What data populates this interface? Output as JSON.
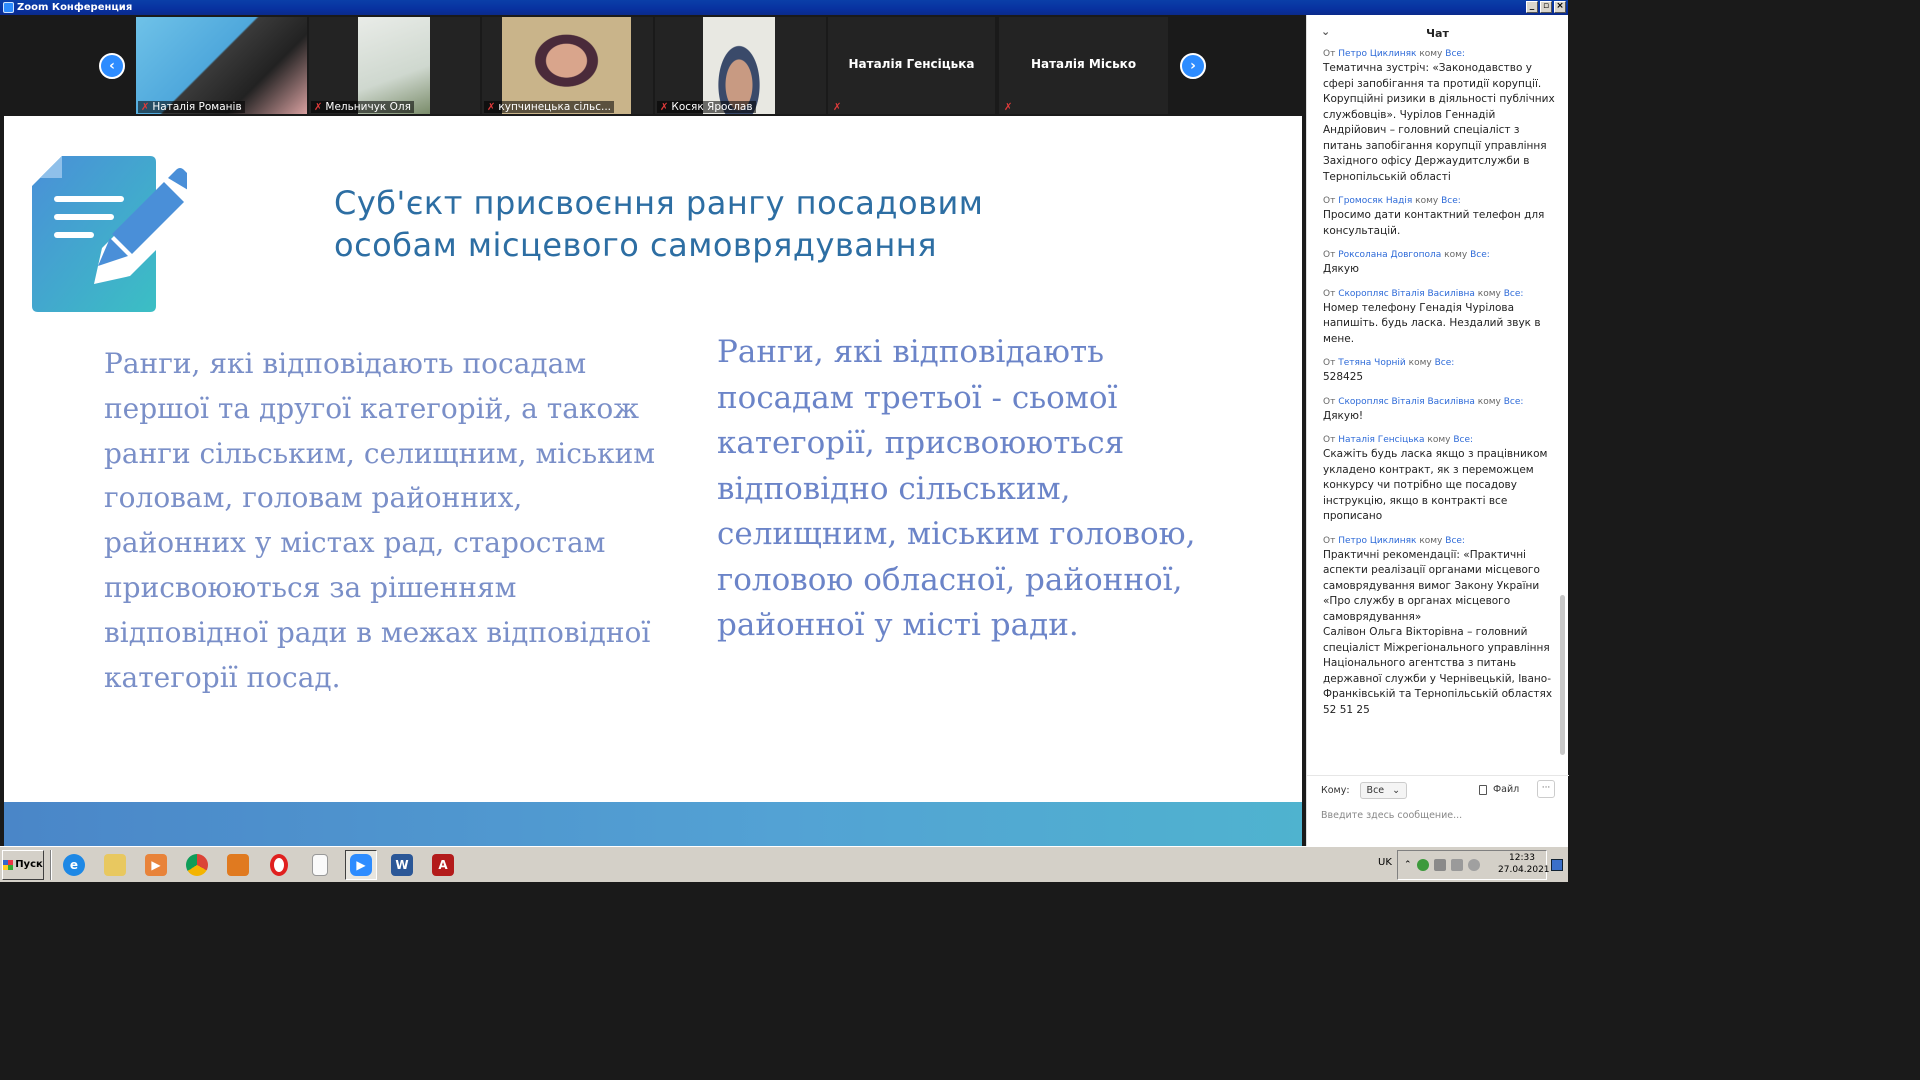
{
  "window": {
    "title": "Zoom Конференция"
  },
  "participants": [
    {
      "name": "Наталія Романів",
      "muted": true
    },
    {
      "name": "Мельничук Оля",
      "muted": true
    },
    {
      "name": "купчинецька сільс...",
      "muted": true
    },
    {
      "name": "Косяк Ярослав",
      "muted": true
    },
    {
      "name": "Наталія Генсіцька",
      "muted": true
    },
    {
      "name": "Наталія Місько",
      "muted": true
    }
  ],
  "slide": {
    "title_line1": "Суб'єкт присвоєння рангу посадовим",
    "title_line2": "особам місцевого самоврядування",
    "left_text": "Ранги, які відповідають посадам першої та другої категорій, а також ранги сільським, селищним, міським головам, головам районних, районних у містах рад, старостам присвоюються за рішенням відповідної ради в межах відповідної категорії посад.",
    "right_text": "Ранги, які відповідають посадам третьої - сьомої категорії, присвоюються відповідно сільським, селищним, міським головою, головою обласної, районної, районної у місті ради."
  },
  "chat": {
    "title": "Чат",
    "messages": [
      {
        "from_prefix": "От",
        "from": "Петро Циклиняк",
        "to_prefix": "кому",
        "to": "Все:",
        "text": "Тематична зустріч: «Законодавство у сфері запобігання та протидії корупції. Корупційні ризики в діяльності публічних службовців».   Чурілов Геннадій Андрійович – головний спеціаліст з питань запобігання корупції управління Західного офісу Держаудитслужби в Тернопільській області"
      },
      {
        "from_prefix": "От",
        "from": "Громосяк Надія",
        "to_prefix": "кому",
        "to": "Все:",
        "text": "Просимо дати контактний телефон для консультацій."
      },
      {
        "from_prefix": "От",
        "from": "Роксолана Довгопола",
        "to_prefix": "кому",
        "to": "Все:",
        "text": "Дякую"
      },
      {
        "from_prefix": "От",
        "from": "Скоропляс Віталія Василівна",
        "to_prefix": "кому",
        "to": "Все:",
        "text": "Номер телефону Генадія Чурілова напишіть. будь ласка. Нездалий звук в мене."
      },
      {
        "from_prefix": "От",
        "from": "Тетяна Чорній",
        "to_prefix": "кому",
        "to": "Все:",
        "text": "528425"
      },
      {
        "from_prefix": "От",
        "from": "Скоропляс Віталія Василівна",
        "to_prefix": "кому",
        "to": "Все:",
        "text": "Дякую!"
      },
      {
        "from_prefix": "От",
        "from": "Наталія Генсіцька",
        "to_prefix": "кому",
        "to": "Все:",
        "text": "Скажіть будь ласка якщо з працівником укладено контракт, як з переможцем конкурсу чи потрібно ще посадову інструкцію, якщо в контракті все прописано"
      },
      {
        "from_prefix": "От",
        "from": "Петро Циклиняк",
        "to_prefix": "кому",
        "to": "Все:",
        "text": "Практичні рекомендації: «Практичні аспекти реалізації органами місцевого самоврядування вимог Закону України «Про службу в органах місцевого самоврядування»\nСалівон Ольга Вікторівна – головний спеціаліст Міжрегіонального управління Національного агентства з питань державної служби у Чернівецькій, Івано-Франківській та Тернопільській областях\n52 51 25"
      }
    ],
    "to_label": "Кому:",
    "to_value": "Все",
    "file_label": "Файл",
    "more_label": "···",
    "input_placeholder": "Введите здесь сообщение..."
  },
  "taskbar": {
    "start_label": "Пуск",
    "language": "UK",
    "time": "12:33",
    "date": "27.04.2021"
  },
  "colors": {
    "accent": "#2d8cff",
    "slide_title": "#2d6ea3",
    "slide_text": "#7a8fc8",
    "chat_sender": "#2d6ad8"
  }
}
